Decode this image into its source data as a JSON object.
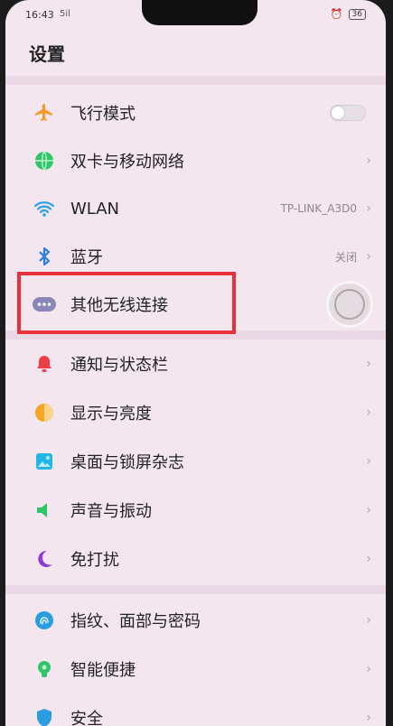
{
  "status_bar": {
    "time": "16:43",
    "signal": "5il",
    "battery": "36"
  },
  "page_title": "设置",
  "items": [
    {
      "label": "飞行模式",
      "value": "",
      "icon": "airplane-icon"
    },
    {
      "label": "双卡与移动网络",
      "value": "",
      "icon": "globe-icon"
    },
    {
      "label": "WLAN",
      "value": "TP-LINK_A3D0",
      "icon": "wifi-icon"
    },
    {
      "label": "蓝牙",
      "value": "关闭",
      "icon": "bluetooth-icon"
    },
    {
      "label": "其他无线连接",
      "value": "",
      "icon": "more-connections-icon"
    },
    {
      "label": "通知与状态栏",
      "value": "",
      "icon": "bell-icon"
    },
    {
      "label": "显示与亮度",
      "value": "",
      "icon": "brightness-icon"
    },
    {
      "label": "桌面与锁屏杂志",
      "value": "",
      "icon": "wallpaper-icon"
    },
    {
      "label": "声音与振动",
      "value": "",
      "icon": "speaker-icon"
    },
    {
      "label": "免打扰",
      "value": "",
      "icon": "moon-icon"
    },
    {
      "label": "指纹、面部与密码",
      "value": "",
      "icon": "fingerprint-icon"
    },
    {
      "label": "智能便捷",
      "value": "",
      "icon": "smart-assist-icon"
    },
    {
      "label": "安全",
      "value": "",
      "icon": "security-icon"
    }
  ],
  "colors": {
    "highlight": "#e8313a",
    "airplane": "#f39a2a",
    "globe": "#2fc66a",
    "wifi": "#2aa0e8",
    "bluetooth": "#2f7fe0"
  }
}
